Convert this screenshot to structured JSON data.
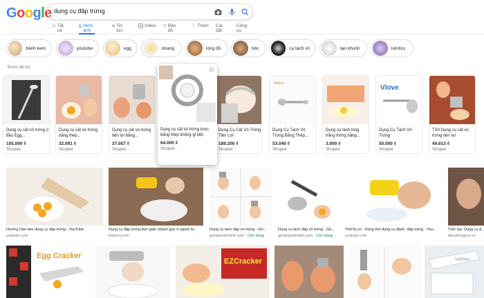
{
  "search": {
    "query": "dụng cụ đập trứng"
  },
  "tabs": [
    "Tất cả",
    "Hình ảnh",
    "Tin tức",
    "Video",
    "Bản đồ",
    "Thêm",
    "Cài đặt",
    "Công cụ"
  ],
  "chips": [
    "bánh kem",
    "youtube",
    "egg",
    "doang",
    "lòng đỏ",
    "bóc",
    "cụ tách vỏ",
    "tạo khuôn",
    "lumtics"
  ],
  "sponsored_label": "Được tài trợ",
  "products": [
    {
      "title": "Dụng cụ cắt vỏ trứng 2 đầu Egg...",
      "price": "105.000 ₫",
      "store": "Shopee"
    },
    {
      "title": "Dụng cụ cắt vỏ trứng bằng thép...",
      "price": "32.091 ₫",
      "store": "Shopee"
    },
    {
      "title": "Dụng cụ cắt vỏ trứng tiện lợi bằng...",
      "price": "37.057 ₫",
      "store": "Shopee"
    },
    {
      "title": "Dụng cụ cắt vỏ trứng lược bằng thép không gỉ tiện",
      "price": "64.000 ₫",
      "store": "Shopee"
    },
    {
      "title": "Dụng Cụ Cắt Vỏ Trứng Tiện Lợi",
      "price": "189.200 ₫",
      "store": "Shopee"
    },
    {
      "title": "Dụng Cụ Tách Vỏ Trứng Bằng Thép...",
      "price": "53.040 ₫",
      "store": "Shopee"
    },
    {
      "title": "Dụng cụ tách lòng trắng trứng bằng...",
      "price": "3.000 ₫",
      "store": "Shopee"
    },
    {
      "title": "Dụng Cụ Tách Vỏ Trứng",
      "price": "50.000 ₫",
      "store": "Shopee"
    },
    {
      "title": "TS0 Dụng cụ cắt vỏ trứng tiện lợi",
      "price": "49.613 ₫",
      "store": "Shopee"
    }
  ],
  "results_row1": [
    {
      "title": "Hướng Dẫn làm dụng cụ đập trứng - YouTube",
      "source": "youtube.com",
      "stock": ""
    },
    {
      "title": "Dụng cụ đập trứng đơn giản nhanh gọn ít người bi...",
      "source": "baomoi.com",
      "stock": ""
    },
    {
      "title": "Dụng cụ tách đập vỏ trứng - Gổ...",
      "source": "gocbepxinhxinh.com",
      "stock": "Còn hàng"
    },
    {
      "title": "Dụng cụ tách đập vỏ trứng - Gổ...",
      "source": "gocbepxinhxinh.com",
      "stock": "Còn hàng"
    },
    {
      "title": "TinhTe.vn - Dùng thử dụng cụ đánh, đập trứng - You...",
      "source": "youtube.com",
      "stock": ""
    },
    {
      "title": "Trên tay: Dụng cụ đ...",
      "source": "dieudungplus.vn",
      "stock": ""
    }
  ],
  "results_row2": [
    {
      "label": "Egg Cracker"
    },
    {
      "label": ""
    },
    {
      "label": "EZCracker"
    },
    {
      "label": ""
    },
    {
      "label": ""
    },
    {
      "label": ""
    }
  ],
  "colors": {
    "blue": "#4285F4",
    "red": "#EA4335",
    "yellow": "#FBBC05",
    "green": "#34A853",
    "accent": "#1a73e8"
  }
}
